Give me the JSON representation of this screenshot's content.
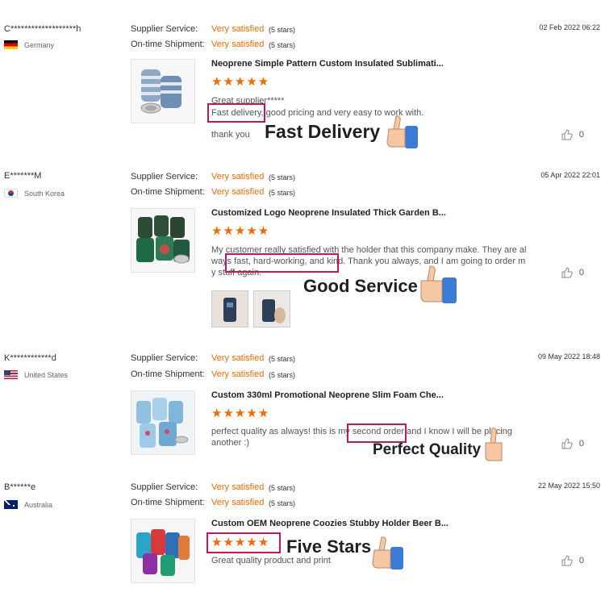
{
  "labels": {
    "supplier_service": "Supplier Service:",
    "ontime_shipment": "On-time Shipment:"
  },
  "reviews": [
    {
      "buyer": "C*******************h",
      "country": "Germany",
      "supplier_rating": "Very satisfied",
      "supplier_stars": "(5 stars)",
      "shipment_rating": "Very satisfied",
      "shipment_stars": "(5 stars)",
      "date": "02 Feb 2022 06:22",
      "product": "Neoprene Simple Pattern Custom Insulated Sublimati...",
      "stars": "★★★★★",
      "text_line1": "Great supplier*****",
      "text_line2": "Fast delivery, good pricing and very easy to work with.",
      "text_line3": "thank you",
      "likes": "0",
      "callout": "Fast Delivery"
    },
    {
      "buyer": "E*******M",
      "country": "South Korea",
      "supplier_rating": "Very satisfied",
      "supplier_stars": "(5 stars)",
      "shipment_rating": "Very satisfied",
      "shipment_stars": "(5 stars)",
      "date": "05 Apr 2022 22:01",
      "product": "Customized Logo Neoprene Insulated Thick Garden B...",
      "stars": "★★★★★",
      "text": "My customer really satisfied with the holder that this company make. They are always fast, hard-working, and kind. Thank you always, and I am going to order my stuff again.",
      "likes": "0",
      "callout": "Good Service"
    },
    {
      "buyer": "K************d",
      "country": "United States",
      "supplier_rating": "Very satisfied",
      "supplier_stars": "(5 stars)",
      "shipment_rating": "Very satisfied",
      "shipment_stars": "(5 stars)",
      "date": "09 May 2022 18:48",
      "product": "Custom 330ml Promotional Neoprene Slim Foam Che...",
      "stars": "★★★★★",
      "text": "perfect quality as always! this is my second order and I know I will be placing another :)",
      "likes": "0",
      "callout": "Perfect Quality"
    },
    {
      "buyer": "B******e",
      "country": "Australia",
      "supplier_rating": "Very satisfied",
      "supplier_stars": "(5 stars)",
      "shipment_rating": "Very satisfied",
      "shipment_stars": "(5 stars)",
      "date": "22 May 2022 15:50",
      "product": "Custom OEM Neoprene Coozies Stubby Holder Beer B...",
      "stars": "★★★★★",
      "text": "Great quality product and print",
      "likes": "0",
      "callout": "Five Stars"
    }
  ],
  "colors": {
    "accent": "#f56a00",
    "highlight_box": "#c2185b",
    "hand_skin": "#f6c7a0",
    "hand_cuff": "#3a7bd5"
  }
}
